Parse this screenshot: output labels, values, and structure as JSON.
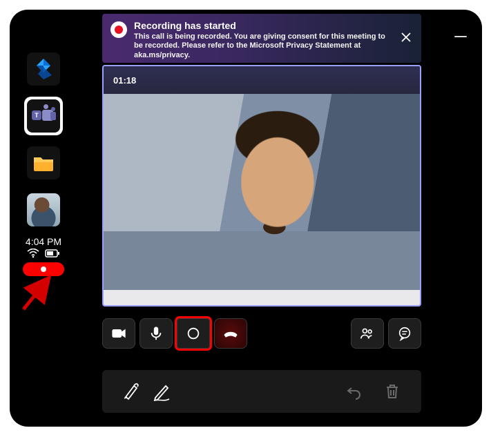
{
  "sidebar": {
    "apps": [
      {
        "name": "dynamics"
      },
      {
        "name": "teams",
        "active": true
      },
      {
        "name": "files"
      },
      {
        "name": "profile"
      }
    ],
    "clock": "4:04 PM"
  },
  "notification": {
    "title": "Recording has started",
    "body": "This call is being recorded. You are giving consent for this meeting to be recorded. Please refer to the Microsoft Privacy Statement at aka.ms/privacy."
  },
  "video": {
    "timer": "01:18",
    "participant_name": " "
  },
  "call_controls": {
    "camera": "camera",
    "mic": "microphone",
    "record": "record",
    "hangup": "hang-up",
    "participants": "participants",
    "chat": "chat"
  },
  "penbar": {
    "ink": "ink-pen",
    "edit": "edit-pencil",
    "undo": "undo",
    "delete": "delete"
  }
}
